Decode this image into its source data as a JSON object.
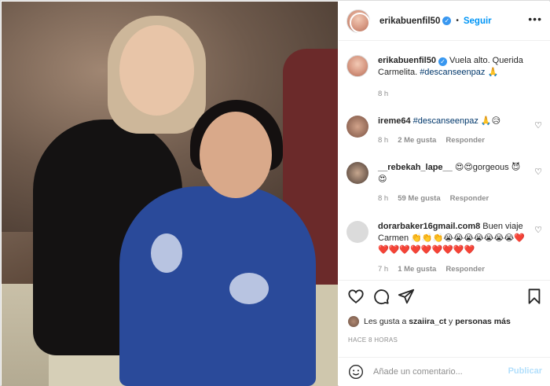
{
  "post": {
    "username": "erikabuenfil50",
    "follow_label": "Seguir",
    "separator": "•",
    "more_label": "•••",
    "caption_text": "Vuela alto. Querida Carmelita.",
    "caption_hashtag": "#descanseenpaz",
    "caption_emoji": "🙏",
    "caption_time": "8 h"
  },
  "comments": [
    {
      "username": "ireme64",
      "hashtag": "#descanseenpaz",
      "text": "🙏😥",
      "time": "8 h",
      "likes": "2 Me gusta",
      "reply": "Responder"
    },
    {
      "username": "__rebekah_lape__",
      "text": "😍😍gorgeous 😈😍",
      "time": "8 h",
      "likes": "59 Me gusta",
      "reply": "Responder"
    },
    {
      "username": "dorarbaker16gmail.com8",
      "text": "Buen viaje Carmen 👏👏👏😭😭😭😭😭😭😭❤️❤️❤️❤️❤️❤️❤️❤️❤️❤️",
      "time": "7 h",
      "likes": "1 Me gusta",
      "reply": "Responder"
    }
  ],
  "likes": {
    "prefix": "Les gusta a",
    "user": "szaiira_ct",
    "middle": "y",
    "others": "personas más"
  },
  "timestamp": "HACE 8 HORAS",
  "composer": {
    "placeholder": "Añade un comentario...",
    "publish_label": "Publicar"
  },
  "colors": {
    "accent": "#0095f6",
    "verified": "#3897f0",
    "muted": "#8e8e8e",
    "publish_disabled": "#b2dffc"
  }
}
